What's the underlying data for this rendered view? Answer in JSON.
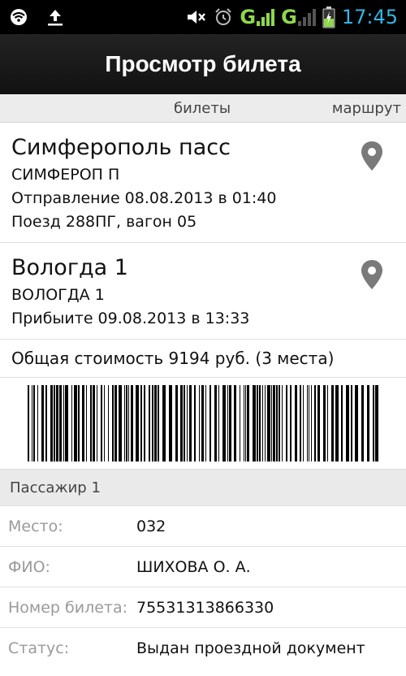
{
  "status_bar": {
    "left_icons": [
      "wifi-icon",
      "upload-icon"
    ],
    "right_icons": [
      "mute-icon",
      "alarm-icon",
      "signal-g-icon",
      "signal-g-icon",
      "battery-charging-icon"
    ],
    "network_1": "G",
    "network_2": "G",
    "time": "17:45",
    "accent": "#33b5e5"
  },
  "action_bar": {
    "title": "Просмотр билета"
  },
  "tabs": {
    "tickets": "билеты",
    "route": "маршрут"
  },
  "departure": {
    "station": "Симферополь пасс",
    "code": "СИМФЕРОП П",
    "datetime": "Отправление 08.08.2013 в 01:40",
    "train": "Поезд 288ПГ, вагон 05",
    "icon": "map-pin-icon"
  },
  "arrival": {
    "station": "Вологда 1",
    "code": "ВОЛОГДА 1",
    "datetime": "Прибыите 09.08.2013 в 13:33",
    "icon": "map-pin-icon"
  },
  "total_cost": "Общая стоимость 9194 руб. (3 места)",
  "passenger": {
    "header": "Пассажир 1",
    "rows": [
      {
        "label": "Место:",
        "value": "032"
      },
      {
        "label": "ФИО:",
        "value": "ШИХОВА О. А."
      },
      {
        "label": "Номер билета:",
        "value": "75531313866330"
      },
      {
        "label": "Статус:",
        "value": "Выдан проездной документ"
      }
    ]
  }
}
